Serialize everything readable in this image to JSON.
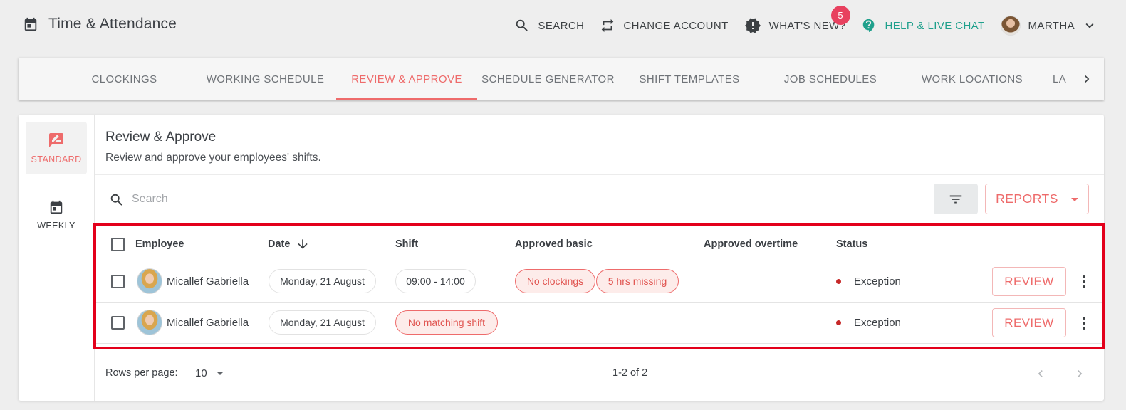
{
  "app": {
    "title": "Time & Attendance"
  },
  "top_actions": {
    "search": "SEARCH",
    "change_account": "CHANGE ACCOUNT",
    "whats_new": "WHAT'S NEW?",
    "whats_new_badge": "5",
    "help": "HELP & LIVE CHAT",
    "user": "MARTHA"
  },
  "tabs": [
    "CLOCKINGS",
    "WORKING SCHEDULE",
    "REVIEW & APPROVE",
    "SCHEDULE GENERATOR",
    "SHIFT TEMPLATES",
    "JOB SCHEDULES",
    "WORK LOCATIONS",
    "LA"
  ],
  "active_tab": "REVIEW & APPROVE",
  "sidebar": {
    "standard": "STANDARD",
    "weekly": "WEEKLY"
  },
  "page": {
    "title": "Review & Approve",
    "subtitle": "Review and approve your employees' shifts."
  },
  "search": {
    "placeholder": "Search",
    "value": ""
  },
  "reports_label": "REPORTS",
  "table": {
    "headers": {
      "employee": "Employee",
      "date": "Date",
      "shift": "Shift",
      "approved_basic": "Approved basic",
      "approved_overtime": "Approved overtime",
      "status": "Status"
    },
    "rows": [
      {
        "employee": "Micallef Gabriella",
        "date": "Monday, 21 August",
        "shift": "09:00 - 14:00",
        "approved_basic": [
          "No clockings",
          "5 hrs missing"
        ],
        "status": "Exception",
        "action": "REVIEW"
      },
      {
        "employee": "Micallef Gabriella",
        "date": "Monday, 21 August",
        "shift": "No matching shift",
        "approved_basic": [],
        "status": "Exception",
        "action": "REVIEW"
      }
    ]
  },
  "pagination": {
    "rows_per_page_label": "Rows per page:",
    "rows_per_page": "10",
    "range": "1-2 of 2"
  },
  "colors": {
    "accent": "#ee6b6b",
    "help": "#1fa08c",
    "badge": "#e8415f",
    "highlight": "#e3001b",
    "status_dot": "#c62828"
  }
}
